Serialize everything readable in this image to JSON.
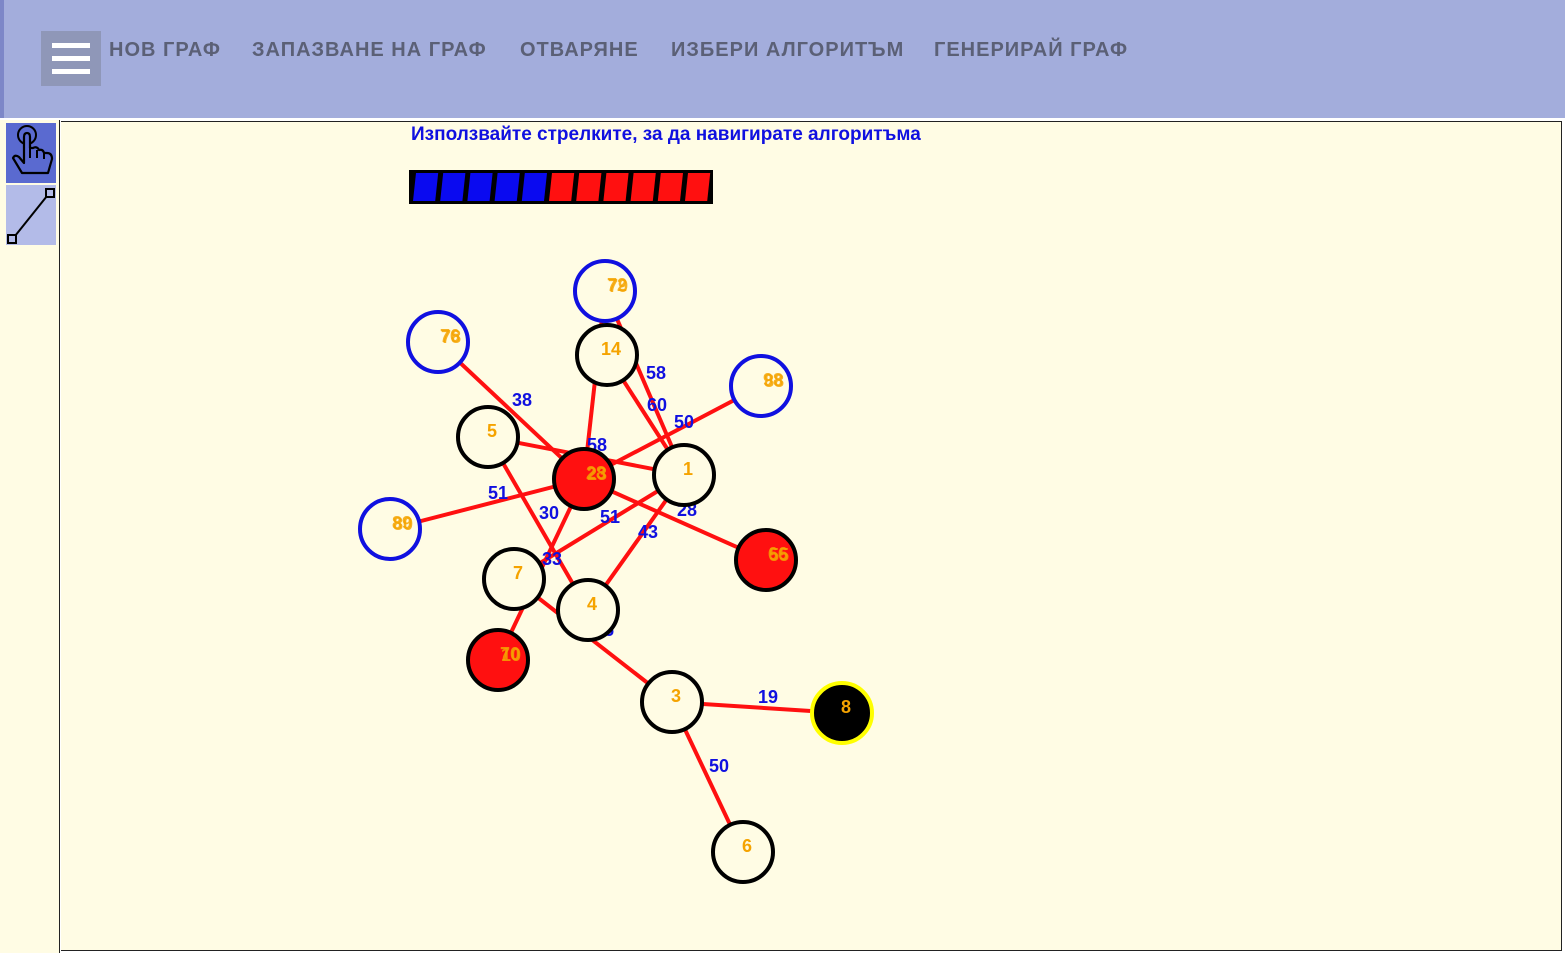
{
  "menu": {
    "items": [
      {
        "key": "new",
        "label": "НОВ ГРАФ"
      },
      {
        "key": "save",
        "label": "ЗАПАЗВАНЕ НА ГРАФ"
      },
      {
        "key": "open",
        "label": "ОТВАРЯНЕ"
      },
      {
        "key": "algorithm",
        "label": "ИЗБЕРИ АЛГОРИТЪМ"
      },
      {
        "key": "generate",
        "label": "ГЕНЕРИРАЙ ГРАФ"
      }
    ]
  },
  "tools": [
    {
      "name": "pointer-tool",
      "icon": "hand-pointer-icon",
      "active": true
    },
    {
      "name": "edge-tool",
      "icon": "line-segment-icon",
      "active": false
    }
  ],
  "hint": "Използвайте стрелките, за да навигирате алгоритъма",
  "progress": {
    "done_steps": 5,
    "total_steps": 11,
    "done_color": "#0a0af0",
    "todo_color": "#ff1010"
  },
  "colors": {
    "edge": "#ff1010",
    "weight": "#1010e0",
    "node_label": "#f5a300",
    "visited": "#ff1010",
    "frontier": "#1010e0",
    "current": "#000000",
    "current_ring": "#ffff00"
  },
  "graph": {
    "nodes": [
      {
        "id": "n72",
        "label": "72",
        "label2": "79",
        "state": "frontier"
      },
      {
        "id": "n14",
        "label": "14",
        "state": "normal"
      },
      {
        "id": "n76",
        "label": "76",
        "label2": "78",
        "state": "frontier"
      },
      {
        "id": "n98",
        "label": "98",
        "label2": "88",
        "state": "frontier"
      },
      {
        "id": "n5",
        "label": "5",
        "state": "normal"
      },
      {
        "id": "n28",
        "label": "28",
        "label2": "23",
        "state": "visited"
      },
      {
        "id": "n1",
        "label": "1",
        "state": "normal"
      },
      {
        "id": "n89",
        "label": "89",
        "label2": "80",
        "state": "frontier"
      },
      {
        "id": "n66",
        "label": "66",
        "label2": "55",
        "state": "visited"
      },
      {
        "id": "n7",
        "label": "7",
        "state": "normal"
      },
      {
        "id": "n4",
        "label": "4",
        "state": "normal"
      },
      {
        "id": "n70",
        "label": "70",
        "label2": "10",
        "state": "visited"
      },
      {
        "id": "n3",
        "label": "3",
        "state": "normal"
      },
      {
        "id": "n8",
        "label": "8",
        "state": "current"
      },
      {
        "id": "n6",
        "label": "6",
        "state": "normal"
      }
    ],
    "edges": [
      {
        "from": "n76",
        "to": "n28",
        "weight": "38"
      },
      {
        "from": "n72",
        "to": "n28",
        "weight": "38"
      },
      {
        "from": "n72",
        "to": "n1",
        "weight": "58"
      },
      {
        "from": "n14",
        "to": "n1",
        "weight": "60"
      },
      {
        "from": "n98",
        "to": "n28",
        "weight": "50"
      },
      {
        "from": "n5",
        "to": "n1",
        "weight": "58"
      },
      {
        "from": "n89",
        "to": "n28",
        "weight": "51"
      },
      {
        "from": "n5",
        "to": "n4",
        "weight": "30"
      },
      {
        "from": "n1",
        "to": "n7",
        "weight": "51"
      },
      {
        "from": "n28",
        "to": "n66",
        "weight": "28"
      },
      {
        "from": "n1",
        "to": "n4",
        "weight": "43"
      },
      {
        "from": "n28",
        "to": "n70",
        "weight": "33"
      },
      {
        "from": "n7",
        "to": "n3",
        "weight": "45"
      },
      {
        "from": "n3",
        "to": "n8",
        "weight": "19"
      },
      {
        "from": "n3",
        "to": "n6",
        "weight": "50"
      }
    ]
  }
}
